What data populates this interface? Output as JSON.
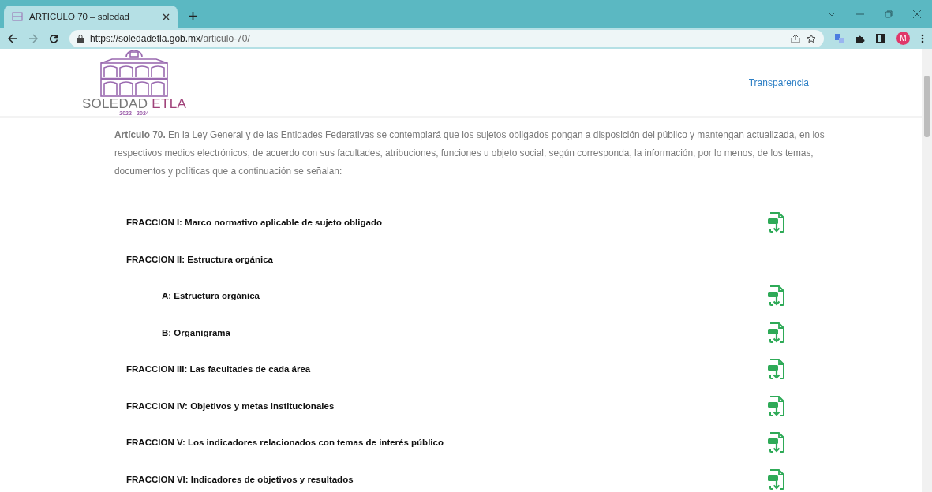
{
  "browser": {
    "tab_title": "ARTICULO 70 – soledad",
    "url_host": "https://soledadetla.gob.mx",
    "url_path": "/articulo-70/",
    "profile_initial": "M"
  },
  "logo": {
    "name": "SOLEDAD",
    "accent": "ETLA",
    "years": "2022 - 2024"
  },
  "nav": {
    "link": "Transparencia"
  },
  "intro": "**Artículo 70.** En la Ley General y de las Entidades Federativas se contemplará que los sujetos obligados pongan a disposición del público y mantengan actualizada, en los respectivos medios electrónicos, de acuerdo con sus facultades, atribuciones, funciones u objeto social, según corresponda, la información, por lo menos, de los temas, documentos y políticas que a continuación se señalan:",
  "items": [
    {
      "kind": "section",
      "label": "FRACCION I: Marco normativo aplicable de sujeto obligado",
      "download": true
    },
    {
      "kind": "section",
      "label": "FRACCION II: Estructura orgánica",
      "download": false
    },
    {
      "kind": "sub",
      "label": "A: Estructura orgánica",
      "download": true
    },
    {
      "kind": "sub",
      "label": "B: Organigrama",
      "download": true
    },
    {
      "kind": "section",
      "label": "FRACCION III: Las facultades de cada área",
      "download": true
    },
    {
      "kind": "section",
      "label": "FRACCION IV: Objetivos y metas institucionales",
      "download": true
    },
    {
      "kind": "section",
      "label": "FRACCION V: Los indicadores relacionados con temas de interés público",
      "download": true
    },
    {
      "kind": "section",
      "label": "FRACCION VI: Indicadores de objetivos y resultados",
      "download": true
    }
  ]
}
